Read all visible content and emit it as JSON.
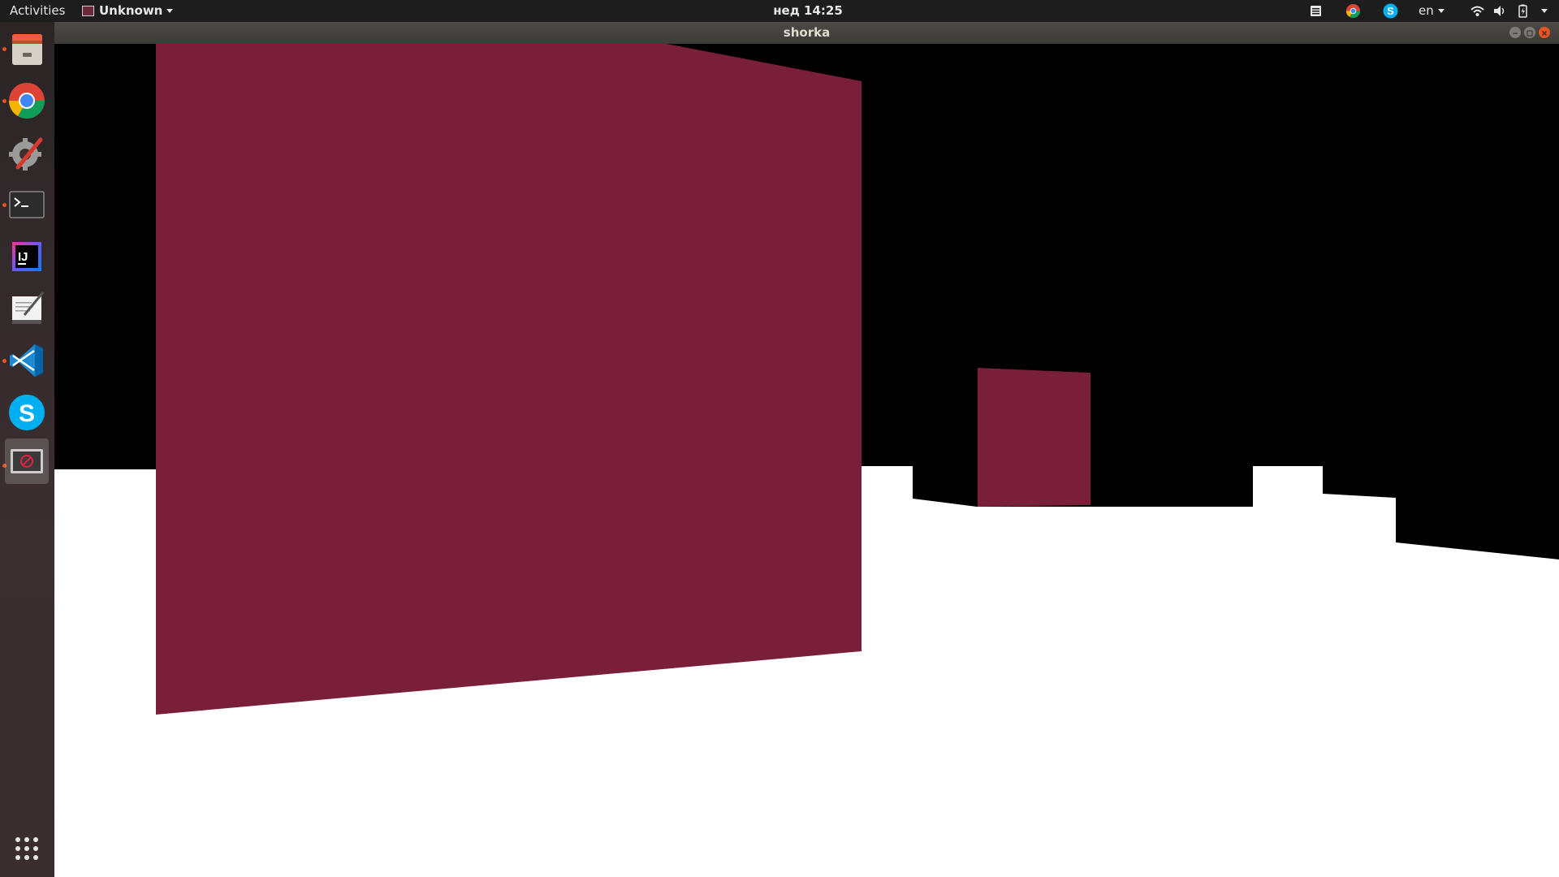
{
  "topbar": {
    "activities": "Activities",
    "app_menu": "Unknown",
    "clock": "нед 14:25",
    "keyboard_layout": "en",
    "tray_icons": [
      "notes-icon",
      "chrome-icon",
      "skype-icon",
      "wifi-icon",
      "volume-icon",
      "battery-icon"
    ]
  },
  "window": {
    "title": "shorka"
  },
  "dock": {
    "apps": [
      {
        "name": "files-icon",
        "running": true
      },
      {
        "name": "chrome-icon",
        "running": true
      },
      {
        "name": "settings-icon",
        "running": false
      },
      {
        "name": "terminal-icon",
        "running": true
      },
      {
        "name": "intellij-icon",
        "running": false
      },
      {
        "name": "text-editor-icon",
        "running": false
      },
      {
        "name": "vscode-icon",
        "running": true
      },
      {
        "name": "skype-icon",
        "running": false
      },
      {
        "name": "shorka-app-icon",
        "running": true,
        "active": true
      }
    ],
    "show_apps": "show-applications-icon"
  },
  "colors": {
    "wall": "#7a1f3a",
    "floor": "#ffffff",
    "sky": "#000000",
    "accent": "#e95420"
  }
}
